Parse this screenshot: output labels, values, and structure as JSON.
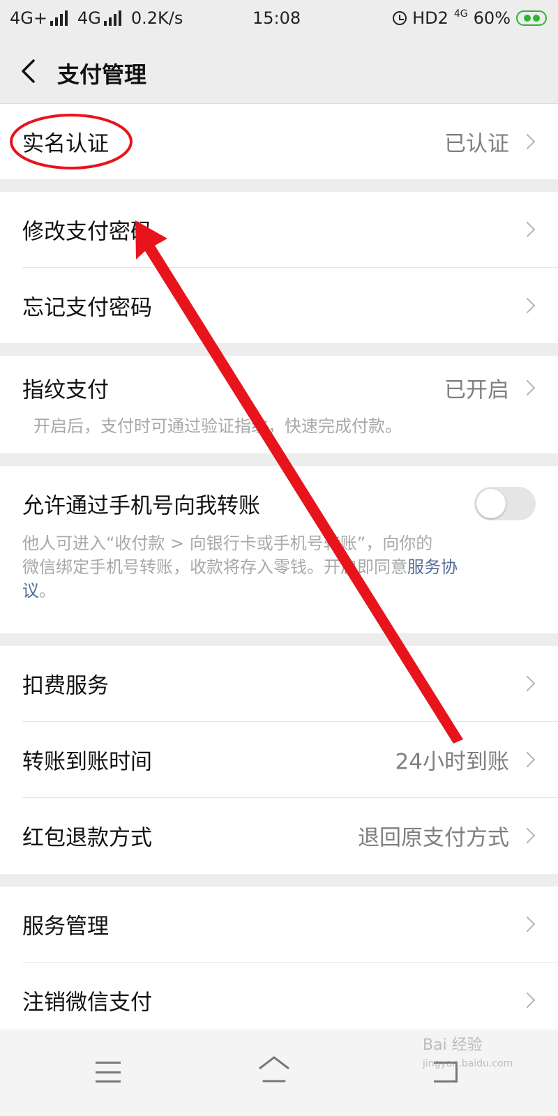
{
  "status_bar": {
    "network1": "4G+",
    "network2": "4G",
    "speed": "0.2K/s",
    "time": "15:08",
    "hd": "HD2",
    "net_small": "4G",
    "battery": "60%"
  },
  "header": {
    "title": "支付管理"
  },
  "sections": {
    "realname": {
      "label": "实名认证",
      "value": "已认证"
    },
    "change_password": {
      "label": "修改支付密码"
    },
    "forgot_password": {
      "label": "忘记支付密码"
    },
    "fingerprint": {
      "label": "指纹支付",
      "value": "已开启",
      "desc": "开启后，支付时可通过验证指纹，快速完成付款。"
    },
    "phone_transfer": {
      "label": "允许通过手机号向我转账",
      "toggle_on": false,
      "desc_line1": "他人可进入“收付款 > 向银行卡或手机号转账”，向你的",
      "desc_line2_text": "微信绑定手机号转账，收款将存入零钱。开启即同意",
      "desc_link_part1": "服务协",
      "desc_link_part2": "议",
      "desc_end": "。"
    },
    "deduction": {
      "label": "扣费服务"
    },
    "transfer_time": {
      "label": "转账到账时间",
      "value": "24小时到账"
    },
    "refund_method": {
      "label": "红包退款方式",
      "value": "退回原支付方式"
    },
    "service_manage": {
      "label": "服务管理"
    },
    "cancel_pay": {
      "label": "注销微信支付"
    }
  },
  "watermark": {
    "text": "Bai 经验",
    "url": "jingyan.baidu.com"
  },
  "colors": {
    "annotation_red": "#e8141c",
    "link": "#576b95",
    "switch_off": "#e5e5e5"
  }
}
